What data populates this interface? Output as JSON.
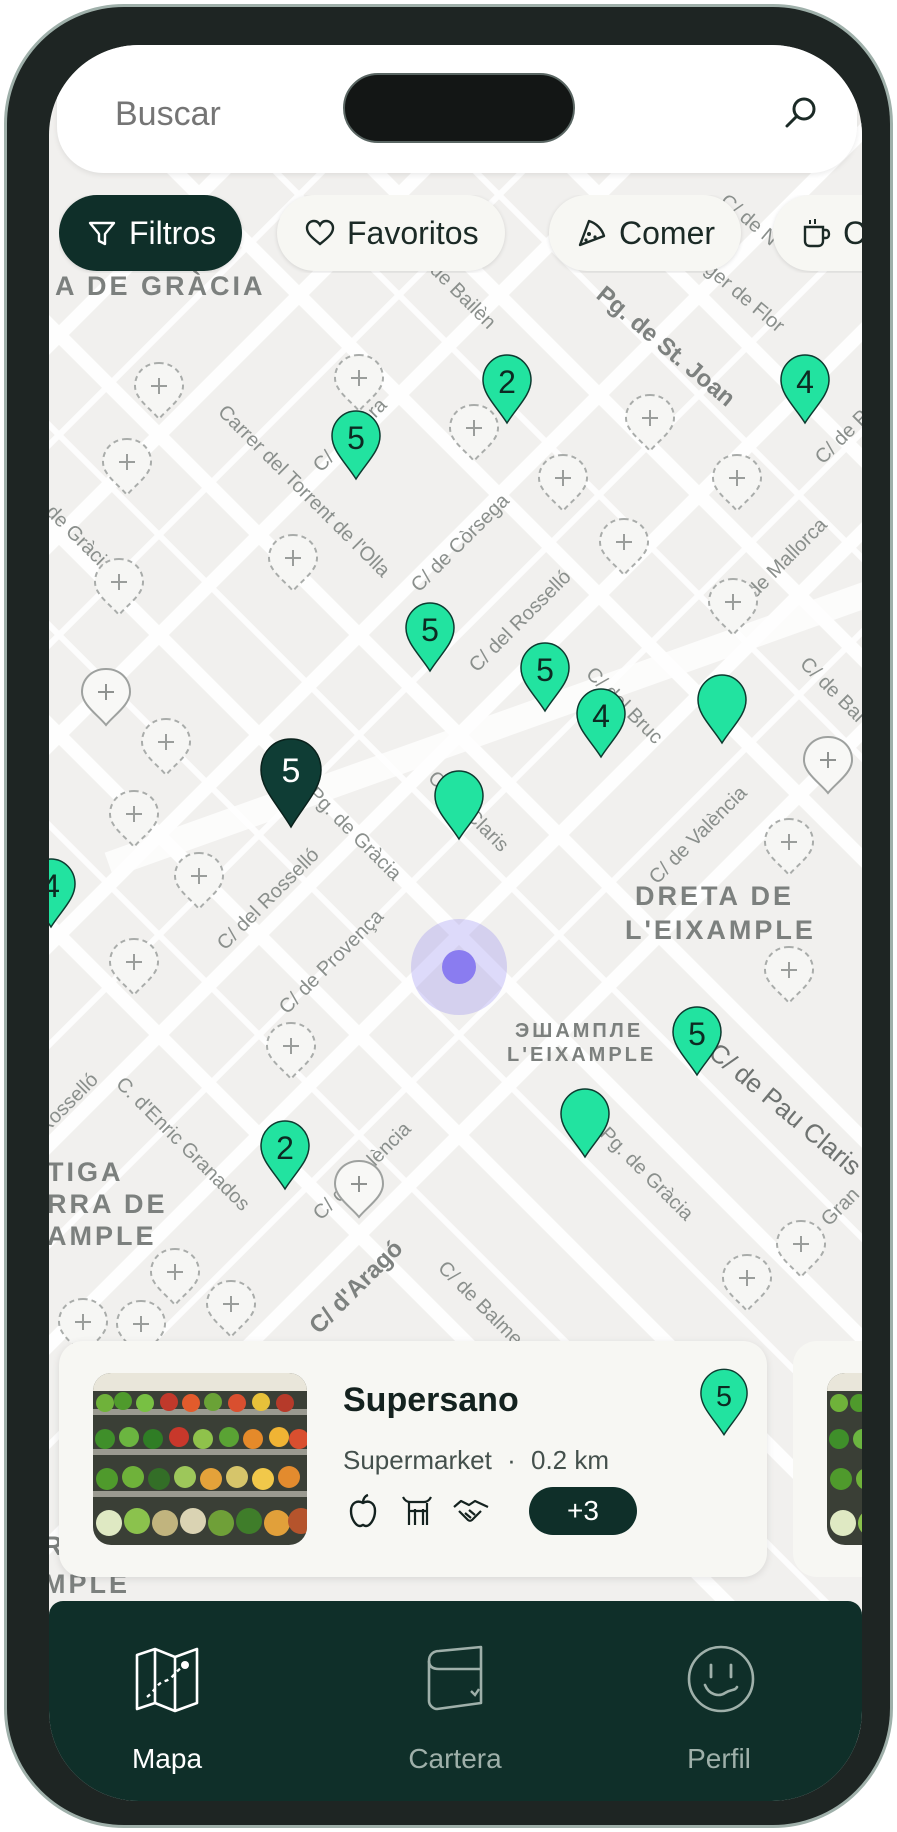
{
  "search": {
    "placeholder": "Buscar"
  },
  "filters": [
    {
      "label": "Filtros",
      "icon": "filter-icon"
    },
    {
      "label": "Favoritos",
      "icon": "heart-icon"
    },
    {
      "label": "Comer",
      "icon": "pizza-icon"
    },
    {
      "label": "Ca",
      "icon": "coffee-cup-icon"
    }
  ],
  "map": {
    "districts": [
      "A DE GRÀCIA",
      "DRETA DE",
      "L'EIXAMPLE",
      "ЭШАМПЛЕ",
      "L'EIXAMPLE",
      "TIGA",
      "RRA DE",
      "AMPLE",
      "R",
      "MPLE"
    ],
    "streets": [
      "Pg. de St. Joan",
      "de Bailèn",
      "Carrer del Torrent de l'Olla",
      "C/ de Còrsega",
      "C/ del Rosselló",
      "C/ del Bruc",
      "C/ de Mallorca",
      "C/ de València",
      "C/ de Pau Claris",
      "Pg. de Gràcia",
      "C/ del Rosselló",
      "C/ de Provença",
      "C. d'Enric Granados",
      "C/ de València",
      "C/ d'Aragó",
      "C/ de Balmes",
      "Pg. de Gràcia",
      "de Gràcia",
      "Rosselló",
      "C/ de Bai",
      "C/ de Pr",
      "Gran",
      "C/ de Claris",
      "Ciger de Flor",
      "C/ de Vera",
      "C/ de N"
    ],
    "clusters": [
      "2",
      "4",
      "5",
      "5",
      "5",
      "4",
      "5",
      "5",
      "2",
      "4"
    ]
  },
  "card": {
    "title": "Supersano",
    "category": "Supermarket",
    "separator": "·",
    "distance": "0.2 km",
    "attributes": [
      "apple-icon",
      "cow-icon",
      "handshake-icon"
    ],
    "more": "+3",
    "pin_count": "5"
  },
  "tabs": [
    {
      "label": "Mapa",
      "icon": "map-icon",
      "active": true
    },
    {
      "label": "Cartera",
      "icon": "wallet-icon",
      "active": false
    },
    {
      "label": "Perfil",
      "icon": "smiley-icon",
      "active": false
    }
  ],
  "colors": {
    "brand_dark": "#0f2f29",
    "pin_green": "#22e3a0",
    "user_location": "#8a7cf0",
    "map_bg": "#f1f0ee"
  }
}
